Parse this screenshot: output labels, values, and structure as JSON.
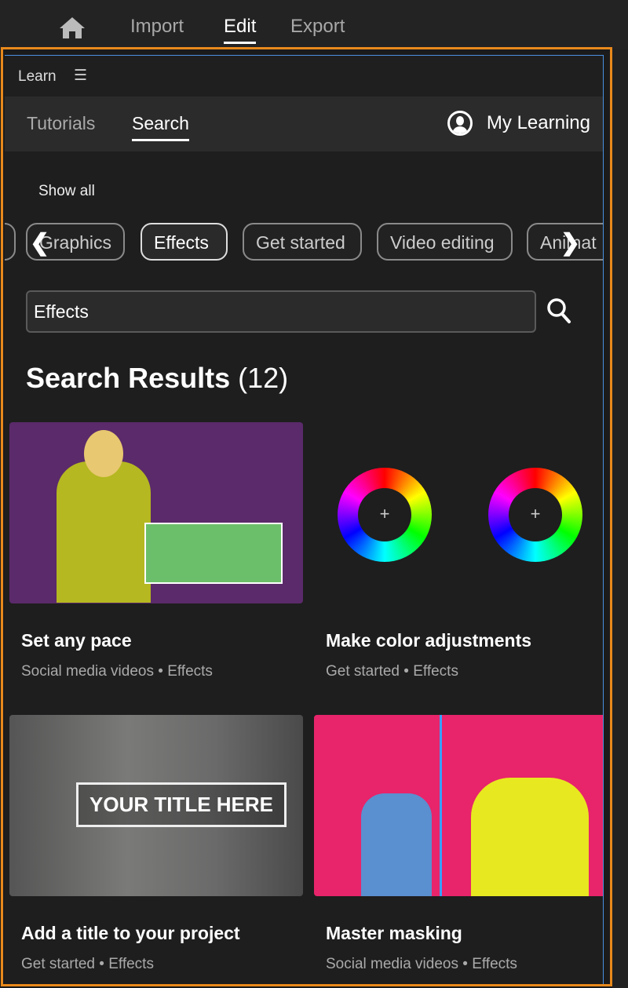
{
  "topbar": {
    "nav": [
      "Import",
      "Edit",
      "Export"
    ],
    "active": "Edit"
  },
  "learn": {
    "title": "Learn"
  },
  "tabs": {
    "items": [
      "Tutorials",
      "Search"
    ],
    "active": "Search",
    "my_learning": "My Learning"
  },
  "filters": {
    "show_all": "Show all",
    "chips": [
      "Graphics",
      "Effects",
      "Get started",
      "Video editing",
      "Animat"
    ],
    "active": "Effects"
  },
  "search": {
    "value": "Effects"
  },
  "results": {
    "label": "Search Results",
    "count": "(12)"
  },
  "cards": [
    {
      "title": "Set any pace",
      "category": "Social media videos",
      "tag": "Effects"
    },
    {
      "title": "Make color adjustments",
      "category": "Get started",
      "tag": "Effects"
    },
    {
      "title": "Add a title to your project",
      "category": "Get started",
      "tag": "Effects",
      "overlay": "YOUR TITLE HERE"
    },
    {
      "title": "Master masking",
      "category": "Social media videos",
      "tag": "Effects"
    }
  ],
  "colors": {
    "frame": "#e8891c",
    "focus": "#4a90e2"
  }
}
